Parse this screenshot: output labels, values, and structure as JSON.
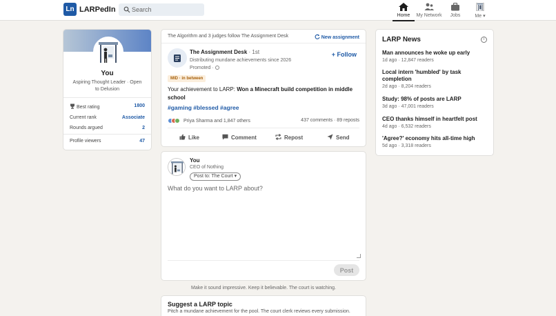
{
  "header": {
    "logo_text": "Ln",
    "brand": "LARPedIn",
    "search_placeholder": "Search",
    "nav": [
      {
        "label": "Home",
        "icon": "home-icon",
        "active": true
      },
      {
        "label": "My Network",
        "icon": "network-icon"
      },
      {
        "label": "Jobs",
        "icon": "briefcase-icon"
      },
      {
        "label": "Me ▾",
        "icon": "avatar-icon"
      }
    ]
  },
  "profile": {
    "name": "You",
    "bio": "Aspiring Thought Leader · Open to Delusion",
    "stats": [
      {
        "label": "Best rating",
        "value": "1800"
      },
      {
        "label": "Current rank",
        "value": "Associate"
      },
      {
        "label": "Rounds argued",
        "value": "2"
      },
      {
        "label": "Profile viewers",
        "value": "47"
      }
    ]
  },
  "post": {
    "context": "The Algorithm and 3 judges follow The Assignment Desk",
    "new_assignment": "New assignment",
    "author": "The Assignment Desk",
    "degree": " · 1st",
    "tagline": "Distributing mundane achievements since 2026",
    "promoted": "Promoted ·",
    "follow": "+ Follow",
    "badge": "MID · in between",
    "body_prefix": "Your achievement to LARP: ",
    "body_bold": "Won a Minecraft build competition in middle school",
    "hashtags": "#gaming #blessed #agree",
    "reactions_text": "Priya Sharma and 1,847 others",
    "counts": "437 comments · 89 reposts",
    "actions": {
      "like": "Like",
      "comment": "Comment",
      "repost": "Repost",
      "send": "Send"
    }
  },
  "compose": {
    "name": "You",
    "title": "CEO of Nothing",
    "post_to": "Post to: The Court ▾",
    "placeholder": "What do you want to LARP about?",
    "post_button": "Post"
  },
  "hint": "Make it sound impressive. Keep it believable. The court is watching.",
  "suggest": {
    "title": "Suggest a LARP topic",
    "desc": "Pitch a mundane achievement for the pool. The court clerk reviews every submission."
  },
  "news": {
    "title": "LARP News",
    "items": [
      {
        "title": "Man announces he woke up early",
        "meta": "1d ago · 12,847 readers"
      },
      {
        "title": "Local intern 'humbled' by task completion",
        "meta": "2d ago · 8,204 readers"
      },
      {
        "title": "Study: 98% of posts are LARP",
        "meta": "3d ago · 47,001 readers"
      },
      {
        "title": "CEO thanks himself in heartfelt post",
        "meta": "4d ago · 6,532 readers"
      },
      {
        "title": "'Agree?' economy hits all-time high",
        "meta": "5d ago · 3,318 readers"
      }
    ]
  },
  "colors": {
    "accent": "#1f5aa6",
    "badge_bg": "#fbeedc",
    "badge_text": "#a65f0a",
    "page_bg": "#f4f2ee"
  }
}
